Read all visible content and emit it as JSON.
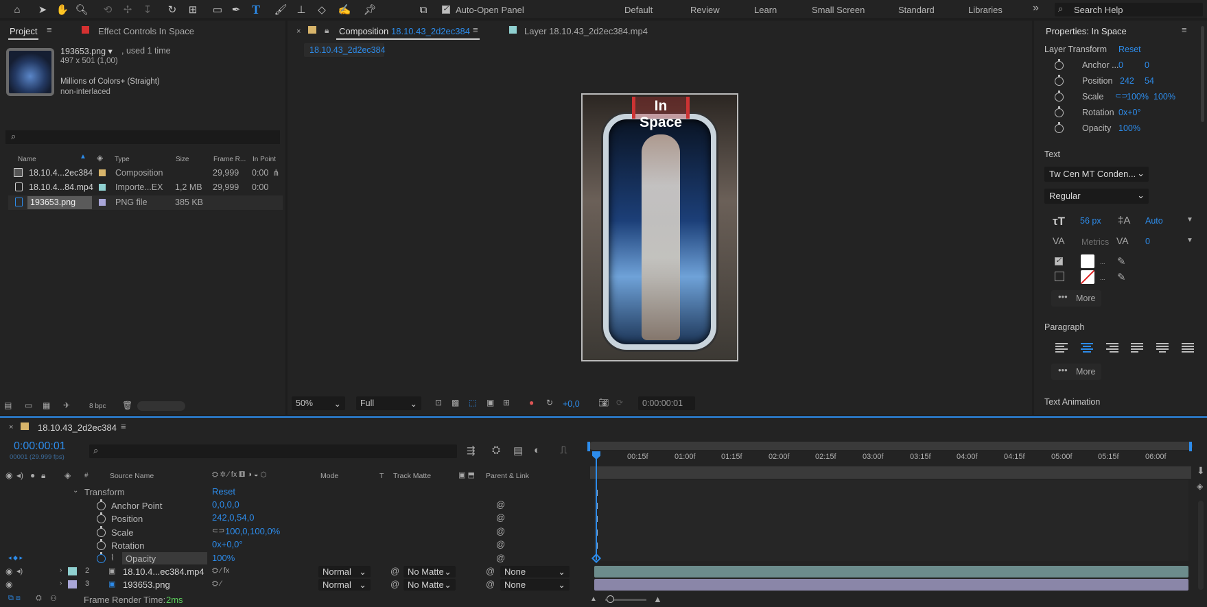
{
  "toolbar": {
    "auto_open_label": "Auto-Open Panel",
    "workspaces": [
      "Default",
      "Review",
      "Learn",
      "Small Screen",
      "Standard",
      "Libraries"
    ],
    "more_glyph": "»",
    "search_placeholder": "Search Help"
  },
  "project": {
    "tab_label": "Project",
    "effect_controls_label": "Effect Controls In Space",
    "asset": {
      "name": "193653.png ▾",
      "used": ", used 1 time",
      "dimensions": "497 x 501 (1,00)",
      "colors": "Millions of Colors+ (Straight)",
      "interlace": "non-interlaced"
    },
    "columns": {
      "name": "Name",
      "type": "Type",
      "size": "Size",
      "frame_rate": "Frame R...",
      "in_point": "In Point"
    },
    "items": [
      {
        "name": "18.10.4...2ec384",
        "type": "Composition",
        "size": "",
        "frame_rate": "29,999",
        "in_point": "0:00",
        "color": "#d7b46a"
      },
      {
        "name": "18.10.4...84.mp4",
        "type": "Importe...EX",
        "size": "1,2 MB",
        "frame_rate": "29,999",
        "in_point": "0:00",
        "color": "#8fd0d0"
      },
      {
        "name": "193653.png",
        "type": "PNG file",
        "size": "385 KB",
        "frame_rate": "",
        "in_point": "",
        "color": "#a9a6d8"
      }
    ],
    "bpc": "8 bpc"
  },
  "composition": {
    "tab_prefix": "Composition",
    "tab_name": "18.10.43_2d2ec384",
    "layer_tab": "Layer  18.10.43_2d2ec384.mp4",
    "crumb": "18.10.43_2d2ec384",
    "overlay_text": "In Space",
    "zoom": "50%",
    "resolution": "Full",
    "exposure": "+0,0",
    "timecode": "0:00:00:01"
  },
  "properties": {
    "title": "Properties: In Space",
    "layer_transform": "Layer Transform",
    "reset": "Reset",
    "anchor_label": "Anchor ...",
    "anchor": [
      "0",
      "0"
    ],
    "position_label": "Position",
    "position": [
      "242",
      "54"
    ],
    "scale_label": "Scale",
    "scale": [
      "100%",
      "100%"
    ],
    "rotation_label": "Rotation",
    "rotation": "0x+0°",
    "opacity_label": "Opacity",
    "opacity": "100%",
    "text_section": "Text",
    "font": "Tw Cen MT Conden...",
    "style": "Regular",
    "font_size": "56 px",
    "leading": "Auto",
    "kerning": "Metrics",
    "tracking": "0",
    "more": "More",
    "paragraph_section": "Paragraph",
    "text_animation": "Text Animation"
  },
  "timeline": {
    "comp_name": "18.10.43_2d2ec384",
    "timecode": "0:00:00:01",
    "frame_info": "00001 (29.999 fps)",
    "columns": {
      "source_name": "Source Name",
      "mode": "Mode",
      "t": "T",
      "track_matte": "Track Matte",
      "parent": "Parent & Link"
    },
    "transform": "Transform",
    "transform_reset": "Reset",
    "props": [
      {
        "name": "Anchor Point",
        "value": "0,0,0,0"
      },
      {
        "name": "Position",
        "value": "242,0,54,0"
      },
      {
        "name": "Scale",
        "value": "100,0,100,0%"
      },
      {
        "name": "Rotation",
        "value": "0x+0,0°"
      },
      {
        "name": "Opacity",
        "value": "100%"
      }
    ],
    "layers": [
      {
        "num": "2",
        "name": "18.10.4...ec384.mp4",
        "mode": "Normal",
        "matte": "No Matte",
        "parent": "None",
        "color": "#8fd0d0"
      },
      {
        "num": "3",
        "name": "193653.png",
        "mode": "Normal",
        "matte": "No Matte",
        "parent": "None",
        "color": "#a9a6d8"
      }
    ],
    "ruler": [
      "00:15f",
      "01:00f",
      "01:15f",
      "02:00f",
      "02:15f",
      "03:00f",
      "03:15f",
      "04:00f",
      "04:15f",
      "05:00f",
      "05:15f",
      "06:00f"
    ],
    "render_label": "Frame Render Time:",
    "render_value": "2ms"
  }
}
